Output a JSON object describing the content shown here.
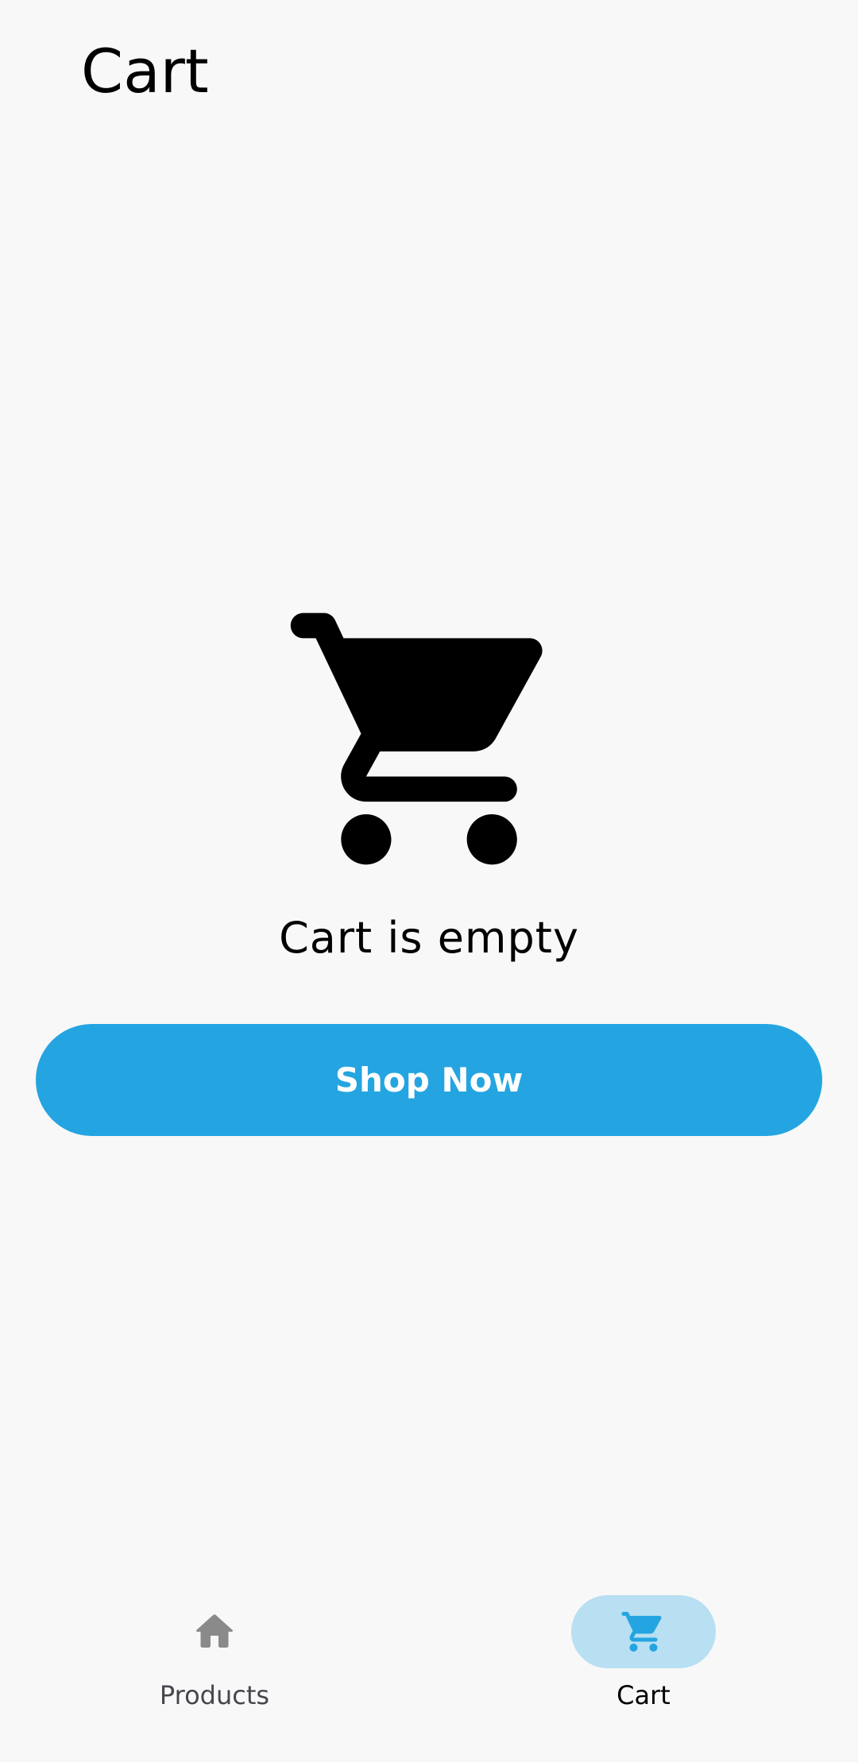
{
  "header": {
    "title": "Cart"
  },
  "empty_state": {
    "icon": "shopping-cart-icon",
    "message": "Cart is empty"
  },
  "actions": {
    "shop_now_label": "Shop Now"
  },
  "bottom_nav": {
    "items": [
      {
        "label": "Products",
        "icon": "home-icon",
        "active": false
      },
      {
        "label": "Cart",
        "icon": "shopping-cart-icon",
        "active": true
      }
    ]
  },
  "colors": {
    "background": "#f8f8f8",
    "accent": "#24a5e1",
    "active_indicator": "#b8dff2",
    "inactive_icon": "#8a8a8a",
    "inactive_label": "#45474d"
  }
}
